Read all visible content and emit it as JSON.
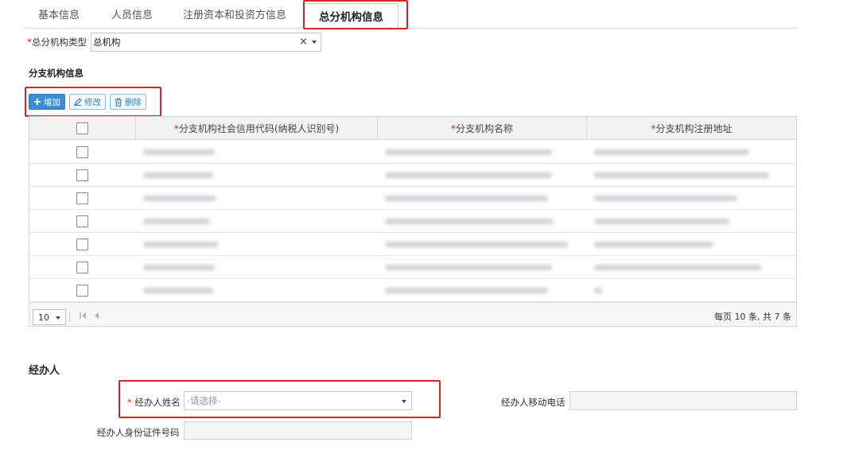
{
  "tabs": [
    {
      "label": "基本信息",
      "active": false
    },
    {
      "label": "人员信息",
      "active": false
    },
    {
      "label": "注册资本和投资方信息",
      "active": false
    },
    {
      "label": "总分机构信息",
      "active": true
    }
  ],
  "hq_type": {
    "required_mark": "*",
    "label": "总分机构类型",
    "value": "总机构",
    "clear_glyph": "×"
  },
  "branch_section": {
    "title": "分支机构信息",
    "toolbar": {
      "add_label": "增加",
      "edit_label": "修改",
      "delete_label": "删除"
    },
    "columns": [
      {
        "required": "*",
        "label": "分支机构社会信用代码(纳税人识别号)"
      },
      {
        "required": "*",
        "label": "分支机构名称"
      },
      {
        "required": "*",
        "label": "分支机构注册地址"
      }
    ],
    "row_count_visible": 7,
    "pager": {
      "page_size": "10",
      "summary": "每页 10 条, 共 7 条"
    }
  },
  "operator": {
    "title": "经办人",
    "name_required": "*",
    "name_label": "经办人姓名",
    "name_placeholder": "-请选择-",
    "phone_label": "经办人移动电话",
    "id_label": "经办人身份证件号码"
  },
  "colors": {
    "highlight_red": "#d8232a",
    "primary_blue": "#3b8fd6",
    "required_red": "#e2231a"
  }
}
